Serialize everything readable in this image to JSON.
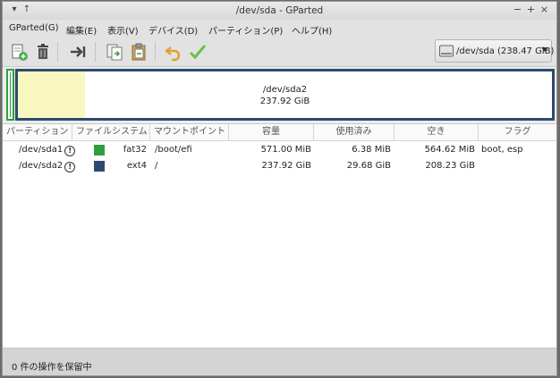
{
  "window": {
    "title": "/dev/sda - GParted"
  },
  "menu": [
    "GParted(G)",
    "編集(E)",
    "表示(V)",
    "デバイス(D)",
    "パーティション(P)",
    "ヘルプ(H)"
  ],
  "device_selector": {
    "label": "/dev/sda (238.47 GiB)"
  },
  "graph": {
    "partition_name": "/dev/sda2",
    "partition_size": "237.92 GiB",
    "used_fraction": 0.125
  },
  "columns": [
    "パーティション",
    "ファイルシステム",
    "マウントポイント",
    "容量",
    "使用済み",
    "空き",
    "フラグ"
  ],
  "partitions": [
    {
      "name": "/dev/sda1",
      "fs": "fat32",
      "fs_color": "#2e9e3e",
      "mount": "/boot/efi",
      "size": "571.00 MiB",
      "used": "6.38 MiB",
      "free": "564.62 MiB",
      "flags": "boot, esp"
    },
    {
      "name": "/dev/sda2",
      "fs": "ext4",
      "fs_color": "#2e4a70",
      "mount": "/",
      "size": "237.92 GiB",
      "used": "29.68 GiB",
      "free": "208.23 GiB",
      "flags": ""
    }
  ],
  "status": {
    "text": "0 件の操作を保留中"
  },
  "colors": {
    "fat32": "#2e9e3e",
    "ext4": "#2e4a70",
    "used": "#f8f7c0",
    "apply": "#6cc04a",
    "undo": "#e0a030"
  }
}
